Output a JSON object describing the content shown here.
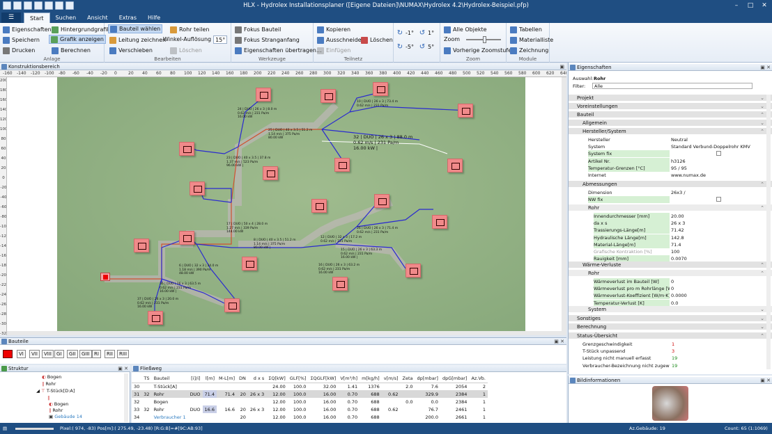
{
  "window": {
    "title": "HLX - Hydrolex Installationsplaner ([Eigene Dateien]\\NUMAX\\Hydrolex 4.2\\Hydrolex-Beispiel.pfp)",
    "min": "–",
    "max": "□",
    "close": "✕"
  },
  "menu": {
    "file_icon": "☰",
    "tabs": [
      "Start",
      "Suchen",
      "Ansicht",
      "Extras",
      "Hilfe"
    ]
  },
  "ribbon": {
    "anlage": {
      "label": "Anlage",
      "eigenschaften": "Eigenschaften",
      "speichern": "Speichern",
      "drucken": "Drucken",
      "hintergrundgrafik": "Hintergrundgrafik",
      "grafik_anzeigen": "Grafik anzeigen",
      "berechnen": "Berechnen"
    },
    "bearbeiten": {
      "label": "Bearbeiten",
      "bauteil_waehlen": "Bauteil wählen",
      "leitung_zeichnen": "Leitung zeichnen",
      "verschieben": "Verschieben",
      "rohr_teilen": "Rohr teilen",
      "winkel_aufloesung": "Winkel-Auflösung",
      "winkel_value": "15°",
      "loeschen": "Löschen"
    },
    "werkzeuge": {
      "label": "Werkzeuge",
      "fokus_bauteil": "Fokus Bauteil",
      "fokus_stranganfang": "Fokus Stranganfang",
      "eig_uebertragen": "Eigenschaften übertragen..."
    },
    "teilnetz": {
      "label": "Teilnetz",
      "kopieren": "Kopieren",
      "ausschneiden": "Ausschneiden",
      "einfuegen": "Einfügen",
      "loeschen": "Löschen"
    },
    "rotate": {
      "cw1": "-1°",
      "ccw1": "1°",
      "cw5": "-5°",
      "ccw5": "5°"
    },
    "zoom": {
      "label": "Zoom",
      "alle_objekte": "Alle Objekte",
      "zoom": "Zoom",
      "vorherige": "Vorherige Zoomstufe"
    },
    "module": {
      "label": "Module",
      "tabellen": "Tabellen",
      "materialliste": "Materialliste",
      "zeichnung": "Zeichnung"
    }
  },
  "konstruktion": {
    "title": "Konstruktionsbereich"
  },
  "ruler_h": [
    "-160",
    "-140",
    "-120",
    "-100",
    "-80",
    "-60",
    "-40",
    "-20",
    "0",
    "20",
    "40",
    "60",
    "80",
    "100",
    "120",
    "140",
    "160",
    "180",
    "200",
    "220",
    "240",
    "260",
    "280",
    "300",
    "320",
    "340",
    "360",
    "380",
    "400",
    "420",
    "440",
    "460",
    "480",
    "500",
    "520",
    "540",
    "560",
    "580",
    "600",
    "620",
    "640"
  ],
  "ruler_v": [
    "200",
    "180",
    "160",
    "140",
    "120",
    "100",
    "80",
    "60",
    "40",
    "20",
    "0",
    "-20",
    "-40",
    "-60",
    "-80",
    "-100",
    "-120",
    "-140",
    "-160",
    "-180",
    "-200",
    "-220",
    "-240",
    "-260",
    "-280",
    "-300",
    "-320"
  ],
  "drawing_labels": {
    "l24": "24 | DUO | 26 x 3 | 8.0 m\n0.62 m/s | 231 Pa/m\n16.00 kW",
    "l25": "25 | DUO | 40 x 3.5 | 51.2 m\n1.14 m/s | 375 Pa/m\n80.00 kW",
    "l32": "32 | DUO | 26 x 3 | 88.0 m\n0.62 m/s | 231 Pa/m\n16.00 kW |",
    "l23": "23 | DUO | 40 x 3.5 | 37.8 m\n1.37 m/s | 523 Pa/m\n96.00 kW |",
    "l17": "17 | DUO | 50 x 4 | 28.0 m\n1.27 m/s | 339 Pa/m\n144.00 kW",
    "l8": "8 | DUO | 40 x 3.5 | 51.2 m\n1.14 m/s | 375 Pa/m\n80.00 kW |",
    "l15": "15 | DUO | 26 x 3 | 63.3 m\n0.62 m/s | 231 Pa/m\n16.00 kW |",
    "l36": "36 | DUO | 26 x 3 | 63.5 m\n0.62 m/s | 231 Pa/m\n16.00 kW |",
    "l37": "37 | DUO | 26 x 3 | 20.0 m\n0.62 m/s | 231 Pa/m\n16.00 kW",
    "l6": "6 | DUO | 32 x 3 | 34.0 m\n1.18 m/s | 390 Pa/m\n48.00 kW",
    "l16": "16 | DUO | 26 x 3 | 63.2 m\n0.62 m/s | 231 Pa/m\n16.00 kW",
    "l10": "10 | DUO | 26 x 3 | 73.4 m\n0.62 m/s | 231 Pa/m",
    "l12": "12 | DUO | 32 x 3 | 17.2 m\n0.62 m/s | 231 Pa/m",
    "l26": "26 | DUO | 26 x 3 | 71.4 m\n0.62 m/s | 231 Pa/m"
  },
  "props": {
    "title": "Eigenschaften",
    "auswahl_label": "Auswahl:",
    "auswahl_value": "Rohr",
    "filter_label": "Filter:",
    "filter_value": "Alle",
    "sections": {
      "projekt": "Projekt",
      "voreinstellungen": "Voreinstellungen",
      "bauteil": "Bauteil",
      "allgemein": "Allgemein",
      "hersteller": "Hersteller/System",
      "abmessungen": "Abmessungen",
      "rohr": "Rohr",
      "waermeverluste": "Wärme-Verluste",
      "rohr2": "Rohr",
      "system": "System",
      "sonstiges": "Sonstiges",
      "berechnung": "Berechnung",
      "status": "Status-Übersicht"
    },
    "hersteller_rows": [
      {
        "k": "Hersteller",
        "v": "Neutral"
      },
      {
        "k": "System",
        "v": "Standard Verbund-Doppelrohr KMV"
      },
      {
        "k": "System fix",
        "v": ""
      },
      {
        "k": "Artikel Nr.",
        "v": "h3126"
      },
      {
        "k": "Temperatur-Grenzen [°C]",
        "v": "95 / 95"
      },
      {
        "k": "Internet",
        "v": "www.numax.de"
      }
    ],
    "abm_rows": [
      {
        "k": "Dimension",
        "v": "26x3 /"
      },
      {
        "k": "NW fix",
        "v": ""
      }
    ],
    "rohr_rows": [
      {
        "k": "Innendurchmesser [mm]",
        "v": "20.00"
      },
      {
        "k": "da x s",
        "v": "26 x 3"
      },
      {
        "k": "Trassierungs-Länge[m]",
        "v": "71.42"
      },
      {
        "k": "Hydraulische Länge[m]",
        "v": "142.8"
      },
      {
        "k": "Material-Länge[m]",
        "v": "71.4"
      },
      {
        "k": "Grafische Kontraktion [%]",
        "v": "100"
      },
      {
        "k": "Rauigkeit [mm]",
        "v": "0.0070"
      }
    ],
    "wv_rows": [
      {
        "k": "Wärmeverlust im Bauteil [W]",
        "v": "0"
      },
      {
        "k": "Wärmeverlust pro m Rohrlänge [W/m]",
        "v": "0"
      },
      {
        "k": "Wärmeverlust-Koeffizient [W/m·K]",
        "v": "0.0000"
      },
      {
        "k": "Temperatur-Verlust [K]",
        "v": "0.0"
      }
    ],
    "status_rows": [
      {
        "k": "Grenzgeschwindigkeit",
        "v": "1"
      },
      {
        "k": "T-Stück unpassend",
        "v": "3"
      },
      {
        "k": "Leistung nicht manuell erfasst",
        "v": "19"
      },
      {
        "k": "Verbraucher-Bezeichnung nicht zugewiesen",
        "v": "19"
      }
    ]
  },
  "bauteile": {
    "title": "Bauteile",
    "buttons": [
      "VI",
      "VII",
      "VIII",
      "GI",
      "GII",
      "GIII",
      "RI",
      "RII",
      "RIII"
    ]
  },
  "struktur": {
    "title": "Struktur",
    "items": [
      "Bogen",
      "Rohr",
      "T-Stück[D:A]",
      "Bogen",
      "Rohr",
      "Gebäude 14"
    ]
  },
  "fliessweg": {
    "title": "Fließweg",
    "headers": [
      "",
      "TS",
      "Bauteil",
      "[i]/i]",
      "l[m]",
      "M-L[m]",
      "DN",
      "d x s",
      "ΣQ[kW]",
      "GLF[%]",
      "ΣQGLF[kW]",
      "V[m³/h]",
      "m[kg/h]",
      "v[m/s]",
      "Zeta",
      "dp[mbar]",
      "dpG[mbar]",
      "Az.Vb."
    ],
    "rows": [
      [
        "30",
        "",
        "T-Stück[A]",
        "",
        "",
        "",
        "",
        "",
        "24.00",
        "100.0",
        "32.00",
        "1.41",
        "1376",
        "",
        "2.0",
        "7.6",
        "2054",
        "2"
      ],
      [
        "31",
        "32",
        "Rohr",
        "DUO",
        "71.4",
        "71.4",
        "20",
        "26 x 3",
        "12.00",
        "100.0",
        "16.00",
        "0.70",
        "688",
        "0.62",
        "",
        "329.9",
        "2384",
        "1"
      ],
      [
        "32",
        "",
        "Bogen",
        "",
        "",
        "",
        "",
        "",
        "12.00",
        "100.0",
        "16.00",
        "0.70",
        "688",
        "",
        "0.0",
        "0.0",
        "2384",
        "1"
      ],
      [
        "33",
        "32",
        "Rohr",
        "DUO",
        "16.6",
        "16.6",
        "20",
        "26 x 3",
        "12.00",
        "100.0",
        "16.00",
        "0.70",
        "688",
        "0.62",
        "",
        "76.7",
        "2461",
        "1"
      ],
      [
        "34",
        "",
        "Verbraucher 1",
        "",
        "",
        "",
        "20",
        "",
        "12.00",
        "100.0",
        "16.00",
        "0.70",
        "688",
        "",
        "",
        "200.0",
        "2661",
        "1"
      ]
    ]
  },
  "bild": {
    "title": "Bildinformationen"
  },
  "status": {
    "pixel": "Pixel:( 974, -83) Pos[m]:( 275.49, -23.48) [R:G:B]=#[9C:AB:93]",
    "gebaeude": "Az.Gebäude: 19",
    "count": "Count: 65  (1:1069)"
  },
  "colors": {
    "accent": "#1f4e82",
    "pipe_blue": "#2a2ad0",
    "pipe_red": "#d05030",
    "node": "#f08a8a"
  }
}
